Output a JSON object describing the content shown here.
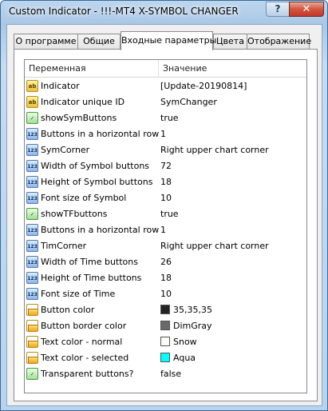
{
  "window": {
    "title": "Custom Indicator - !!!-MT4 X-SYMBOL CHANGER",
    "help_label": "?",
    "close_label": "✕"
  },
  "tabs": [
    {
      "label": "О программе"
    },
    {
      "label": "Общие"
    },
    {
      "label": "Входные параметры"
    },
    {
      "label": "Цвета"
    },
    {
      "label": "Отображение"
    }
  ],
  "active_tab": "Входные параметры",
  "grid": {
    "col_variable": "Переменная",
    "col_value": "Значение",
    "rows": [
      {
        "icon": "string-ab-icon",
        "name": "Indicator",
        "value": "[Update-20190814]"
      },
      {
        "icon": "string-ab-icon",
        "name": "Indicator unique ID",
        "value": "SymChanger"
      },
      {
        "icon": "boolean-icon",
        "name": "showSymButtons",
        "value": "true"
      },
      {
        "icon": "integer-123-icon",
        "name": "Buttons in a horizontal row",
        "value": "1"
      },
      {
        "icon": "integer-123-icon",
        "name": "SymCorner",
        "value": "Right upper chart corner"
      },
      {
        "icon": "integer-123-icon",
        "name": "Width of Symbol buttons",
        "value": "72"
      },
      {
        "icon": "integer-123-icon",
        "name": "Height of Symbol buttons",
        "value": "18"
      },
      {
        "icon": "integer-123-icon",
        "name": "Font size of Symbol",
        "value": "10"
      },
      {
        "icon": "boolean-icon",
        "name": "showTFbuttons",
        "value": "true"
      },
      {
        "icon": "integer-123-icon",
        "name": "Buttons in a horizontal row",
        "value": "1"
      },
      {
        "icon": "integer-123-icon",
        "name": "TimCorner",
        "value": "Right upper chart corner"
      },
      {
        "icon": "integer-123-icon",
        "name": "Width of Time buttons",
        "value": "26"
      },
      {
        "icon": "integer-123-icon",
        "name": "Height of Time buttons",
        "value": "18"
      },
      {
        "icon": "integer-123-icon",
        "name": "Font size of Time",
        "value": "10"
      },
      {
        "icon": "color-icon",
        "name": "Button color",
        "value": "35,35,35",
        "swatch": "#232323"
      },
      {
        "icon": "color-icon",
        "name": "Button border color",
        "value": "DimGray",
        "swatch": "#696969"
      },
      {
        "icon": "color-icon",
        "name": "Text color - normal",
        "value": "Snow",
        "swatch": "#fffafa"
      },
      {
        "icon": "color-icon",
        "name": "Text color - selected",
        "value": "Aqua",
        "swatch": "#00ffff"
      },
      {
        "icon": "boolean-icon",
        "name": "Transparent buttons?",
        "value": "false"
      }
    ]
  }
}
